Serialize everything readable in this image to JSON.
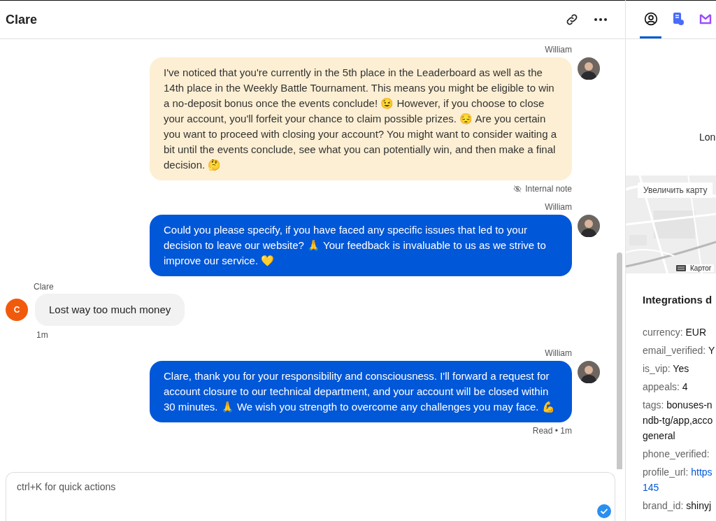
{
  "header": {
    "title": "Clare"
  },
  "messages": [
    {
      "kind": "note",
      "author": "William",
      "text": "I've noticed that you're currently in the 5th place in the Leaderboard as well as the 14th place in the Weekly Battle Tournament. This means you might be eligible to win a no-deposit bonus once the events conclude! 😉 However, if you choose to close your account, you'll forfeit your chance to claim possible prizes. 😔 Are you certain you want to proceed with closing your account? You might want to consider waiting a bit until the events conclude, see what you can potentially win, and then make a final decision. 🤔",
      "footer": "Internal note"
    },
    {
      "kind": "agent",
      "author": "William",
      "text": "Could you please specify, if you have faced any specific issues that led to your decision to leave our website? 🙏 Your feedback is invaluable to us as we strive to improve our service. 💛"
    },
    {
      "kind": "client",
      "author": "Clare",
      "initial": "C",
      "text": "Lost way too much money",
      "footer": "1m"
    },
    {
      "kind": "agent",
      "author": "William",
      "text": "Clare, thank you for your responsibility and consciousness. I'll forward a request for account closure to our technical department, and your account will be closed within 30 minutes. 🙏 We wish you strength to overcome any challenges you may face. 💪",
      "footer": "Read • 1m"
    }
  ],
  "composer": {
    "placeholder": "ctrl+K for quick actions"
  },
  "side_tabs": [
    {
      "kind": "profile",
      "selected": true
    },
    {
      "kind": "notes",
      "selected": false
    },
    {
      "kind": "inbox",
      "selected": false
    }
  ],
  "side": {
    "location": "Lon",
    "map": {
      "kind": "picture",
      "enlarge_button": "Увеличить карту",
      "attribution": "Картог"
    },
    "section_title": "Integrations d",
    "fields": [
      {
        "key": "currency:",
        "value_lines": [
          "EUR"
        ]
      },
      {
        "key": "email_verified:",
        "value_lines": [
          "Y"
        ]
      },
      {
        "key": "is_vip:",
        "value_lines": [
          "Yes"
        ]
      },
      {
        "key": "appeals:",
        "value_lines": [
          "4"
        ]
      },
      {
        "key": "tags:",
        "value_lines": [
          "bonuses-n",
          "ndb-tg/app,acco",
          "general"
        ]
      },
      {
        "key": "phone_verified:"
      },
      {
        "key": "profile_url:",
        "link": true,
        "value_lines": [
          "https",
          "145"
        ]
      },
      {
        "key": "brand_id:",
        "value_lines": [
          "shinyj"
        ]
      }
    ]
  }
}
